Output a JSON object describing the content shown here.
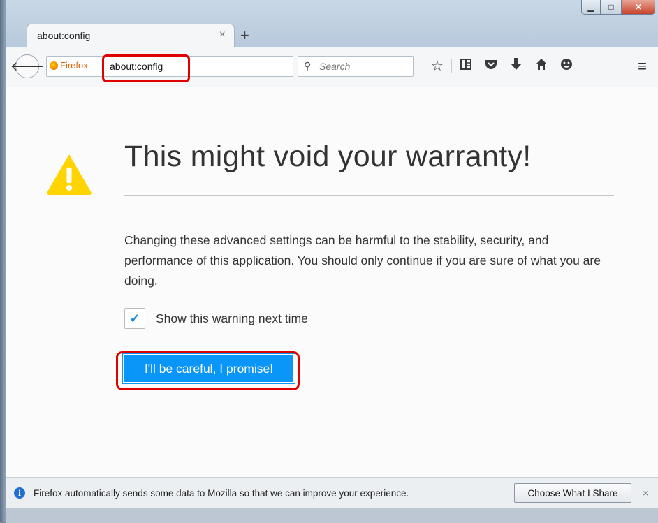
{
  "window": {
    "controls": {
      "minimize": "▁",
      "maximize": "□",
      "close": "✕"
    }
  },
  "tab": {
    "title": "about:config",
    "close": "×",
    "new_tab": "+"
  },
  "toolbar": {
    "back": "🡐",
    "identity_label": "Firefox",
    "url": "about:config",
    "reload": "C",
    "search_icon": "⚲",
    "search_placeholder": "Search",
    "icons": [
      "bookmark-star-icon",
      "bookmarks-list-icon",
      "pocket-icon",
      "downloads-icon",
      "home-icon",
      "hello-icon"
    ],
    "menu": "≡"
  },
  "warning": {
    "title": "This might void your warranty!",
    "body": "Changing these advanced settings can be harmful to the stability, security, and performance of this application. You should only continue if you are sure of what you are doing.",
    "checkbox_label": "Show this warning next time",
    "checkbox_checked": true,
    "button_label": "I'll be careful, I promise!"
  },
  "notification": {
    "text": "Firefox automatically sends some data to Mozilla so that we can improve your experience.",
    "button_label": "Choose What I Share",
    "close": "×"
  },
  "colors": {
    "accent": "#0996f8",
    "highlight": "#e10000",
    "warning": "#ffd400"
  }
}
